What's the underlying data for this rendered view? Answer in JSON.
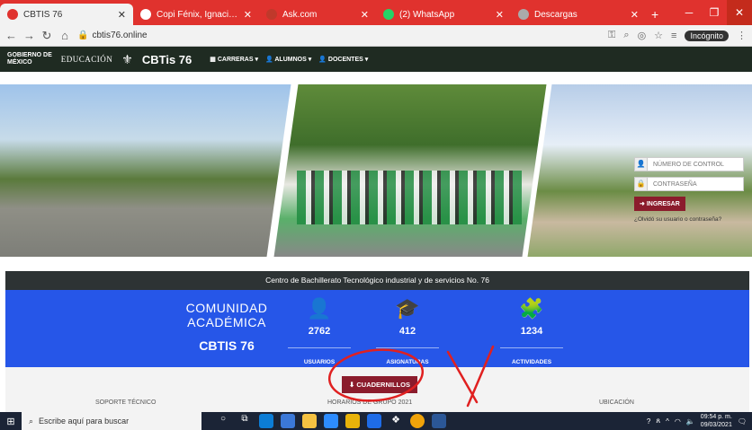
{
  "browser": {
    "tabs": [
      {
        "title": "CBTIS 76",
        "color": "#e0322e",
        "active": true
      },
      {
        "title": "Copi Fénix, Ignacio Maya, Emil",
        "color": "#ffffff",
        "active": false
      },
      {
        "title": "Ask.com",
        "color": "#c0392b",
        "active": false
      },
      {
        "title": "(2) WhatsApp",
        "color": "#25d366",
        "active": false
      },
      {
        "title": "Descargas",
        "color": "#aaaaaa",
        "active": false
      }
    ],
    "new_tab": "+",
    "url": "cbtis76.online",
    "incognito": "Incógnito"
  },
  "site": {
    "gov_line1": "GOBIERNO DE",
    "gov_line2": "MÉXICO",
    "edu": "EDUCACIÓN",
    "logo": "CBTis 76",
    "menu": [
      "CARRERAS",
      "ALUMNOS",
      "DOCENTES"
    ]
  },
  "login": {
    "control_placeholder": "NÚMERO DE CONTROL",
    "password_placeholder": "CONTRASEÑA",
    "submit": "INGRESAR",
    "forgot": "¿Olvidó su usuario o contraseña?"
  },
  "banner": "Centro de Bachillerato Tecnológico industrial y de servicios No. 76",
  "community": {
    "line1": "COMUNIDAD",
    "line2": "ACADÉMICA",
    "line3": "CBTIS 76"
  },
  "stats": [
    {
      "value": "2762",
      "label": "USUARIOS",
      "icon": "user-circle-icon",
      "glyph": "👤"
    },
    {
      "value": "412",
      "label": "ASIGNATURAS",
      "icon": "graduation-cap-icon",
      "glyph": "🎓"
    },
    {
      "value": "1234",
      "label": "ACTIVIDADES",
      "icon": "puzzle-icon",
      "glyph": "🧩"
    }
  ],
  "lower": {
    "cuadernillos": "CUADERNILLOS",
    "soporte": "SOPORTE TÉCNICO",
    "horarios": "HORARIOS DE GRUPO 2021",
    "ubicacion": "UBICACIÓN"
  },
  "taskbar": {
    "search": "Escribe aquí para buscar",
    "time": "09:54 p. m.",
    "date": "09/03/2021"
  },
  "colors": {
    "accent": "#8b1c2c",
    "stats_bg": "#2656e8",
    "annotation": "#e02020"
  }
}
